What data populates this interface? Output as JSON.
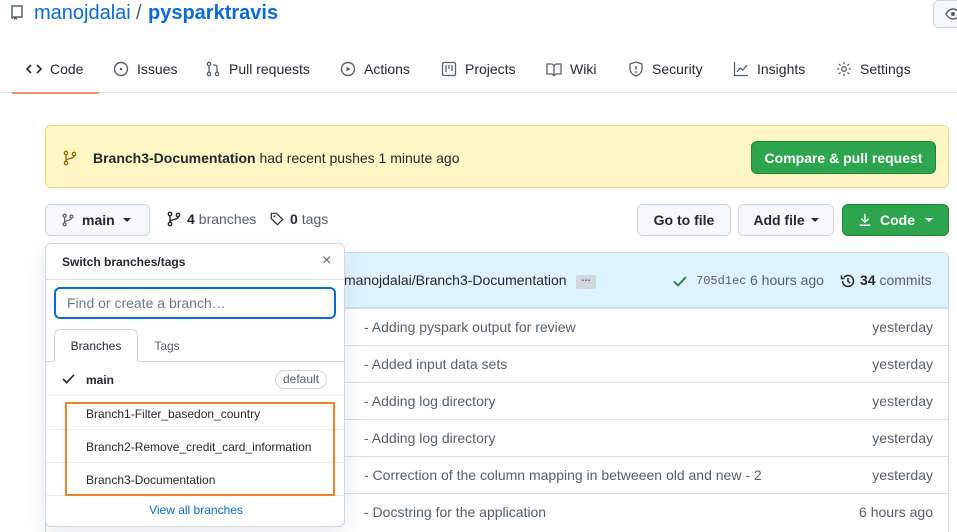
{
  "repo": {
    "owner": "manojdalai",
    "separator": "/",
    "name": "pysparktravis"
  },
  "tabs": [
    {
      "label": "Code",
      "icon": "code-icon",
      "active": true
    },
    {
      "label": "Issues",
      "icon": "issue-icon"
    },
    {
      "label": "Pull requests",
      "icon": "pull-request-icon"
    },
    {
      "label": "Actions",
      "icon": "play-icon"
    },
    {
      "label": "Projects",
      "icon": "project-icon"
    },
    {
      "label": "Wiki",
      "icon": "book-icon"
    },
    {
      "label": "Security",
      "icon": "shield-icon"
    },
    {
      "label": "Insights",
      "icon": "graph-icon"
    },
    {
      "label": "Settings",
      "icon": "gear-icon"
    }
  ],
  "banner": {
    "branch": "Branch3-Documentation",
    "text": "had recent pushes 1 minute ago",
    "button": "Compare & pull request"
  },
  "toolbar": {
    "branch": "main",
    "branches_count": "4",
    "branches_label": "branches",
    "tags_count": "0",
    "tags_label": "tags",
    "go_to_file": "Go to file",
    "add_file": "Add file",
    "code": "Code"
  },
  "latest_commit": {
    "message": "manojdalai/Branch3-Documentation",
    "ellipsis": "…",
    "sha": "705d1ec",
    "time": "6 hours ago",
    "count": "34",
    "count_label": "commits"
  },
  "files": [
    {
      "message": "- Adding pyspark output for review",
      "age": "yesterday"
    },
    {
      "message": "- Added input data sets",
      "age": "yesterday"
    },
    {
      "message": "- Adding log directory",
      "age": "yesterday"
    },
    {
      "message": "- Adding log directory",
      "age": "yesterday"
    },
    {
      "message": "- Correction of the column mapping in betweeen old and new - 2",
      "age": "yesterday"
    },
    {
      "message": "- Docstring for the application",
      "age": "6 hours ago"
    }
  ],
  "dropdown": {
    "title": "Switch branches/tags",
    "close": "×",
    "filter_placeholder": "Find or create a branch…",
    "tab_branches": "Branches",
    "tab_tags": "Tags",
    "branches": [
      {
        "name": "main",
        "checked": true,
        "badge": "default"
      },
      {
        "name": "Branch1-Filter_basedon_country"
      },
      {
        "name": "Branch2-Remove_credit_card_information"
      },
      {
        "name": "Branch3-Documentation"
      }
    ],
    "view_all": "View all branches"
  },
  "colors": {
    "link": "#0969da",
    "green": "#2da44e",
    "banner_bg": "#fff8c5",
    "commit_bg": "#ddf4ff",
    "highlight": "#f0812b",
    "tab_underline": "#fd8c73"
  }
}
